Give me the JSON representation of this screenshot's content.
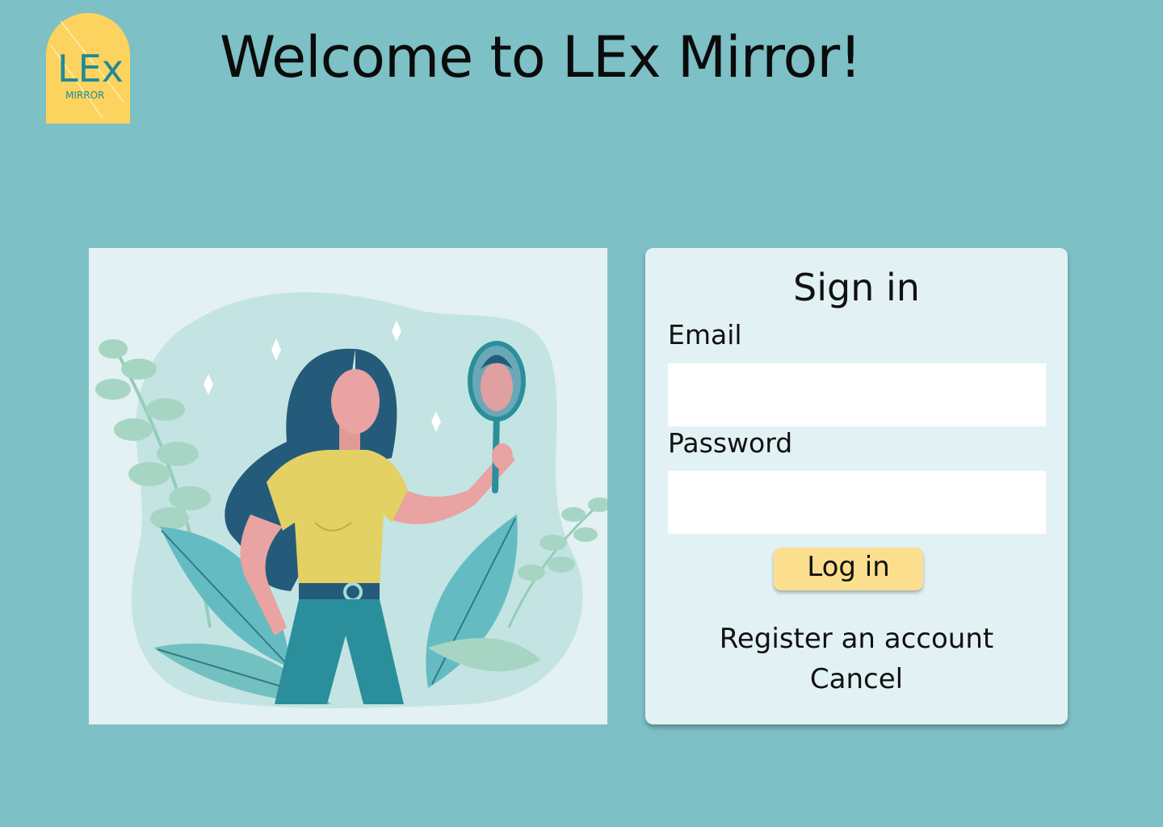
{
  "logo": {
    "word": "LEx",
    "subword": "MIRROR"
  },
  "header": {
    "title": "Welcome to LEx Mirror!"
  },
  "signin": {
    "title": "Sign in",
    "email_label": "Email",
    "email_value": "",
    "password_label": "Password",
    "password_value": "",
    "login_label": "Log in",
    "register_label": "Register an account",
    "cancel_label": "Cancel"
  },
  "colors": {
    "page_background": "#7dc0c6",
    "card_background": "#e2f2f4",
    "button_background": "#fcdf8e",
    "logo_background": "#fcd35e",
    "logo_text": "#1f8a96"
  }
}
